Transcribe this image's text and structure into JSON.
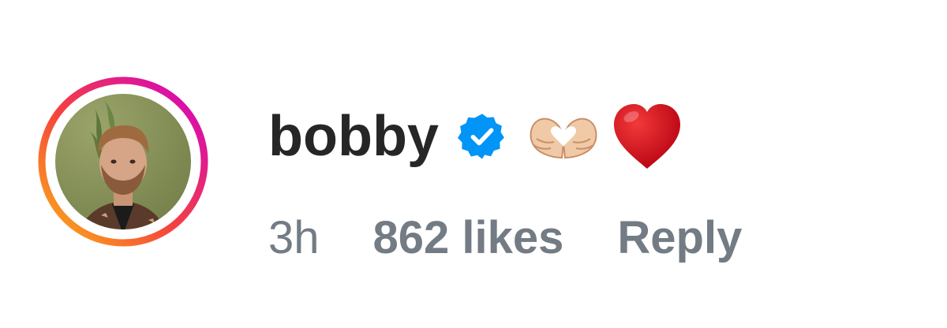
{
  "comment": {
    "username": "bobby",
    "verified": true,
    "body_emojis": [
      "heart-hands",
      "red-heart"
    ],
    "timestamp": "3h",
    "likes_label": "862 likes",
    "reply_label": "Reply"
  },
  "colors": {
    "username": "#262626",
    "meta_text": "#737b84",
    "verified_badge": "#0095f6",
    "story_ring_start": "#f9b015",
    "story_ring_end": "#d300c5",
    "heart": "#d0021b"
  }
}
